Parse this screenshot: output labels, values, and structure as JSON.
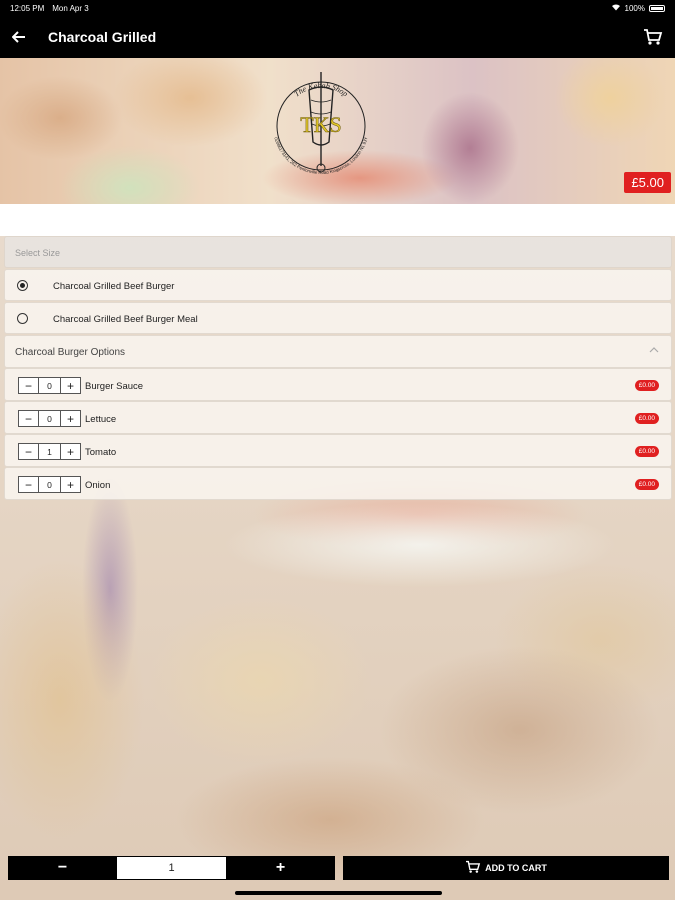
{
  "status_bar": {
    "time": "12:05 PM",
    "date": "Mon Apr 3",
    "battery": "100%"
  },
  "nav": {
    "title": "Charcoal Grilled",
    "back_icon": "arrow-left-icon",
    "cart_icon": "cart-icon"
  },
  "hero": {
    "logo_text_top": "The Kebab Shop",
    "logo_initials": "TKS",
    "logo_address": "02086173141, 262 Pentonville Road Kingscross, London N1 9JY",
    "price": "£5.00"
  },
  "size_section": {
    "header": "Select Size",
    "options": [
      {
        "label": "Charcoal Grilled Beef Burger",
        "selected": true
      },
      {
        "label": "Charcoal Grilled Beef Burger Meal",
        "selected": false
      }
    ]
  },
  "options_section": {
    "header": "Charcoal Burger Options",
    "items": [
      {
        "name": "Burger Sauce",
        "qty": "0",
        "price": "£0.00"
      },
      {
        "name": "Lettuce",
        "qty": "0",
        "price": "£0.00"
      },
      {
        "name": "Tomato",
        "qty": "1",
        "price": "£0.00"
      },
      {
        "name": "Onion",
        "qty": "0",
        "price": "£0.00"
      }
    ]
  },
  "bottom": {
    "minus": "−",
    "qty": "1",
    "plus": "+",
    "add_to_cart": "ADD TO CART"
  },
  "colors": {
    "accent": "#e02020",
    "bar": "#000000"
  }
}
